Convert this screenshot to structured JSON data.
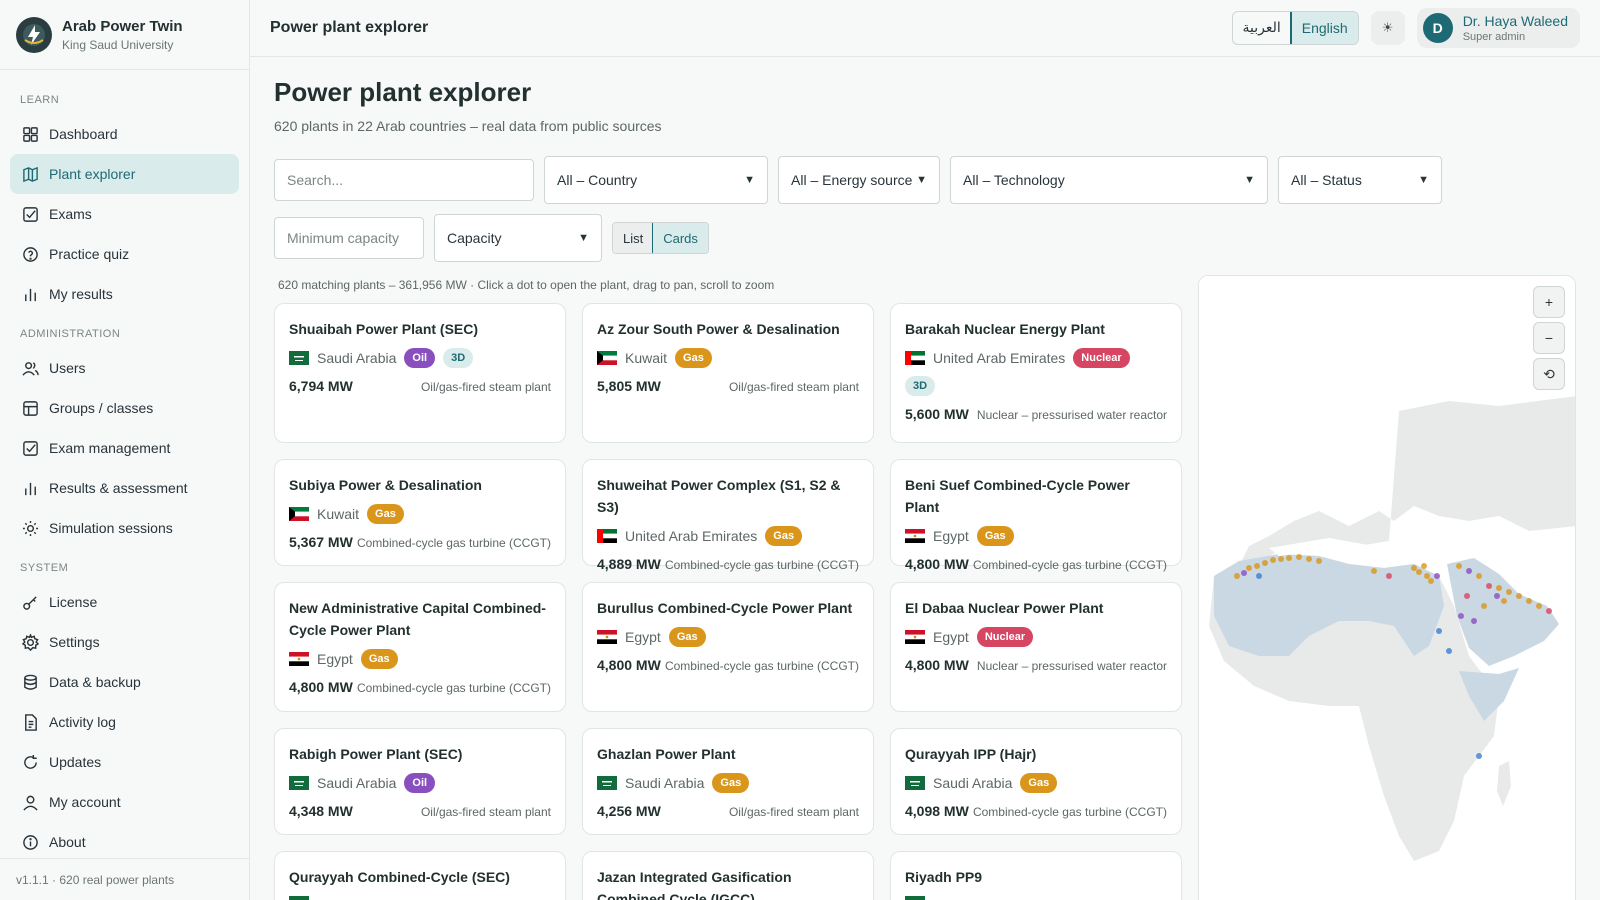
{
  "brand": {
    "name": "Arab Power Twin",
    "org": "King Saud University"
  },
  "topbar": {
    "title": "Power plant explorer",
    "lang_ar": "العربية",
    "lang_en": "English",
    "theme_icon": "☀",
    "user_initial": "D",
    "user_name": "Dr. Haya Waleed",
    "user_role": "Super admin"
  },
  "sidebar": {
    "sections": [
      {
        "label": "LEARN",
        "items": [
          {
            "label": "Dashboard",
            "icon": "dashboard-icon"
          },
          {
            "label": "Plant explorer",
            "icon": "map-icon",
            "active": true
          },
          {
            "label": "Exams",
            "icon": "checkbox-icon"
          },
          {
            "label": "Practice quiz",
            "icon": "help-icon"
          },
          {
            "label": "My results",
            "icon": "bar-chart-icon"
          }
        ]
      },
      {
        "label": "ADMINISTRATION",
        "items": [
          {
            "label": "Users",
            "icon": "users-icon"
          },
          {
            "label": "Groups / classes",
            "icon": "table-icon"
          },
          {
            "label": "Exam management",
            "icon": "checkbox-icon"
          },
          {
            "label": "Results & assessment",
            "icon": "bar-chart-icon"
          },
          {
            "label": "Simulation sessions",
            "icon": "sun-icon"
          }
        ]
      },
      {
        "label": "SYSTEM",
        "items": [
          {
            "label": "License",
            "icon": "key-icon"
          },
          {
            "label": "Settings",
            "icon": "gear-icon"
          },
          {
            "label": "Data & backup",
            "icon": "database-icon"
          },
          {
            "label": "Activity log",
            "icon": "document-icon"
          },
          {
            "label": "Updates",
            "icon": "refresh-icon"
          },
          {
            "label": "My account",
            "icon": "user-icon"
          },
          {
            "label": "About",
            "icon": "info-icon"
          }
        ]
      }
    ],
    "version": "v1.1.1 · 620 real power plants"
  },
  "page": {
    "title": "Power plant explorer",
    "subtitle": "620 plants in 22 Arab countries – real data from public sources",
    "search_placeholder": "Search...",
    "country": "All – Country",
    "energy": "All – Energy source",
    "technology": "All – Technology",
    "status": "All – Status",
    "min_capacity_placeholder": "Minimum capacity",
    "sort": "Capacity",
    "view_list": "List",
    "view_cards": "Cards",
    "status_line": "620 matching plants – 361,956 MW · Click a dot to open the plant, drag to pan, scroll to zoom"
  },
  "colors": {
    "accent": "#1e6a74",
    "gas": "#d9961b",
    "oil": "#8a4fbf",
    "nuclear": "#d64561"
  },
  "plants": [
    {
      "name": "Shuaibah Power Plant (SEC)",
      "country": "Saudi Arabia",
      "flag": "sa",
      "source": "Oil",
      "has3d": true,
      "mw": "6,794 MW",
      "tech": "Oil/gas-fired steam plant"
    },
    {
      "name": "Az Zour South Power & Desalination",
      "country": "Kuwait",
      "flag": "kw",
      "source": "Gas",
      "has3d": false,
      "mw": "5,805 MW",
      "tech": "Oil/gas-fired steam plant"
    },
    {
      "name": "Barakah Nuclear Energy Plant",
      "country": "United Arab Emirates",
      "flag": "ae",
      "source": "Nuclear",
      "has3d": true,
      "mw": "5,600 MW",
      "tech": "Nuclear – pressurised water reactor"
    },
    {
      "name": "Subiya Power & Desalination",
      "country": "Kuwait",
      "flag": "kw",
      "source": "Gas",
      "has3d": false,
      "mw": "5,367 MW",
      "tech": "Combined-cycle gas turbine (CCGT)"
    },
    {
      "name": "Shuweihat Power Complex (S1, S2 & S3)",
      "country": "United Arab Emirates",
      "flag": "ae",
      "source": "Gas",
      "has3d": false,
      "mw": "4,889 MW",
      "tech": "Combined-cycle gas turbine (CCGT)"
    },
    {
      "name": "Beni Suef Combined-Cycle Power Plant",
      "country": "Egypt",
      "flag": "eg",
      "source": "Gas",
      "has3d": false,
      "mw": "4,800 MW",
      "tech": "Combined-cycle gas turbine (CCGT)"
    },
    {
      "name": "New Administrative Capital Combined-Cycle Power Plant",
      "country": "Egypt",
      "flag": "eg",
      "source": "Gas",
      "has3d": false,
      "mw": "4,800 MW",
      "tech": "Combined-cycle gas turbine (CCGT)"
    },
    {
      "name": "Burullus Combined-Cycle Power Plant",
      "country": "Egypt",
      "flag": "eg",
      "source": "Gas",
      "has3d": false,
      "mw": "4,800 MW",
      "tech": "Combined-cycle gas turbine (CCGT)"
    },
    {
      "name": "El Dabaa Nuclear Power Plant",
      "country": "Egypt",
      "flag": "eg",
      "source": "Nuclear",
      "has3d": false,
      "mw": "4,800 MW",
      "tech": "Nuclear – pressurised water reactor"
    },
    {
      "name": "Rabigh Power Plant (SEC)",
      "country": "Saudi Arabia",
      "flag": "sa",
      "source": "Oil",
      "has3d": false,
      "mw": "4,348 MW",
      "tech": "Oil/gas-fired steam plant"
    },
    {
      "name": "Ghazlan Power Plant",
      "country": "Saudi Arabia",
      "flag": "sa",
      "source": "Gas",
      "has3d": false,
      "mw": "4,256 MW",
      "tech": "Oil/gas-fired steam plant"
    },
    {
      "name": "Qurayyah IPP (Hajr)",
      "country": "Saudi Arabia",
      "flag": "sa",
      "source": "Gas",
      "has3d": false,
      "mw": "4,098 MW",
      "tech": "Combined-cycle gas turbine (CCGT)"
    },
    {
      "name": "Qurayyah Combined-Cycle (SEC)",
      "country": "",
      "flag": "sa",
      "source": "",
      "has3d": false,
      "mw": "",
      "tech": ""
    },
    {
      "name": "Jazan Integrated Gasification Combined Cycle (IGCC)",
      "country": "",
      "flag": "",
      "source": "",
      "has3d": false,
      "mw": "",
      "tech": ""
    },
    {
      "name": "Riyadh PP9",
      "country": "",
      "flag": "sa",
      "source": "",
      "has3d": false,
      "mw": "",
      "tech": ""
    }
  ],
  "map": {
    "zoom_in": "+",
    "zoom_out": "−",
    "reset": "⟲"
  }
}
